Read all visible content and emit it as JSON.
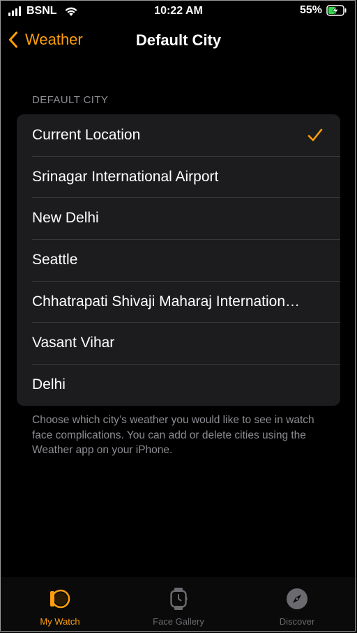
{
  "status_bar": {
    "carrier": "BSNL",
    "time": "10:22 AM",
    "battery_percent": "55%",
    "battery_level": 0.55,
    "charging": true
  },
  "nav": {
    "back_label": "Weather",
    "title": "Default City"
  },
  "section_header": "DEFAULT CITY",
  "cities": [
    {
      "label": "Current Location",
      "selected": true
    },
    {
      "label": "Srinagar International Airport",
      "selected": false
    },
    {
      "label": "New Delhi",
      "selected": false
    },
    {
      "label": "Seattle",
      "selected": false
    },
    {
      "label": "Chhatrapati Shivaji Maharaj Internation…",
      "selected": false
    },
    {
      "label": "Vasant Vihar",
      "selected": false
    },
    {
      "label": "Delhi",
      "selected": false
    }
  ],
  "footnote": "Choose which city’s weather you would like to see in watch face complications. You can add or delete cities using the Weather app on your iPhone.",
  "tab_bar": {
    "tabs": [
      {
        "label": "My Watch",
        "icon": "watch-icon",
        "active": true
      },
      {
        "label": "Face Gallery",
        "icon": "watch-face-icon",
        "active": false
      },
      {
        "label": "Discover",
        "icon": "compass-icon",
        "active": false
      }
    ]
  },
  "colors": {
    "accent": "#ff9f0a",
    "background": "#000000",
    "cell": "#1c1c1e",
    "secondary_text": "#8d8d93"
  }
}
